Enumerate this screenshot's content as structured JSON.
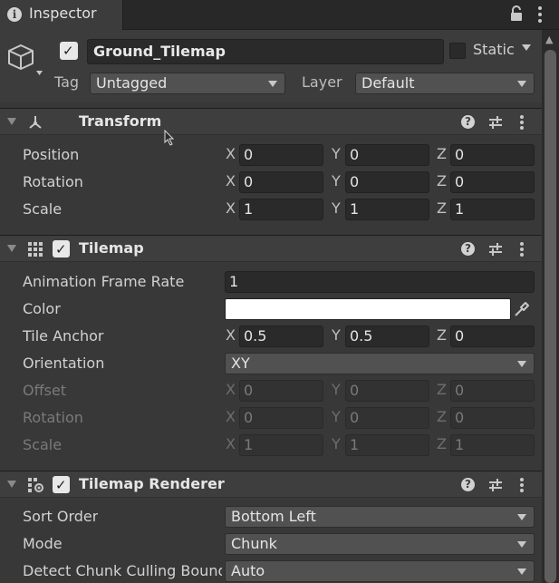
{
  "tab": {
    "title": "Inspector"
  },
  "header": {
    "name": "Ground_Tilemap",
    "static_label": "Static",
    "tag_label": "Tag",
    "tag_value": "Untagged",
    "layer_label": "Layer",
    "layer_value": "Default"
  },
  "transform": {
    "title": "Transform",
    "position": {
      "label": "Position",
      "x": "0",
      "y": "0",
      "z": "0"
    },
    "rotation": {
      "label": "Rotation",
      "x": "0",
      "y": "0",
      "z": "0"
    },
    "scale": {
      "label": "Scale",
      "x": "1",
      "y": "1",
      "z": "1"
    }
  },
  "tilemap": {
    "title": "Tilemap",
    "anim_rate_label": "Animation Frame Rate",
    "anim_rate_value": "1",
    "color_label": "Color",
    "color_value": "#ffffff",
    "tile_anchor": {
      "label": "Tile Anchor",
      "x": "0.5",
      "y": "0.5",
      "z": "0"
    },
    "orientation_label": "Orientation",
    "orientation_value": "XY",
    "offset": {
      "label": "Offset",
      "x": "0",
      "y": "0",
      "z": "0"
    },
    "rotation": {
      "label": "Rotation",
      "x": "0",
      "y": "0",
      "z": "0"
    },
    "scale": {
      "label": "Scale",
      "x": "1",
      "y": "1",
      "z": "1"
    }
  },
  "renderer": {
    "title": "Tilemap Renderer",
    "sort_order_label": "Sort Order",
    "sort_order_value": "Bottom Left",
    "mode_label": "Mode",
    "mode_value": "Chunk",
    "culling_label": "Detect Chunk Culling Bounds",
    "culling_value": "Auto"
  },
  "axis": {
    "x": "X",
    "y": "Y",
    "z": "Z"
  },
  "icons": {
    "tab_info": "info-icon",
    "lock": "lock-icon",
    "tab_menu": "kebab-menu-icon",
    "gameobject": "cube-icon",
    "transform": "transform-icon",
    "tilemap": "grid-icon",
    "renderer": "tilemap-renderer-icon",
    "help": "help-icon",
    "preset": "preset-sliders-icon",
    "component_menu": "kebab-menu-icon",
    "eyedropper": "eyedropper-icon",
    "checkmark": "checkmark-icon"
  },
  "glyphs": {
    "info": "i",
    "check": "✓",
    "help": "?",
    "scroll_up": "▲"
  },
  "colors": {
    "background": "#383838",
    "field": "#2a2a2a",
    "dropdown": "#515151",
    "text": "#d2d2d2",
    "disabled_text": "#7a7a7a"
  }
}
